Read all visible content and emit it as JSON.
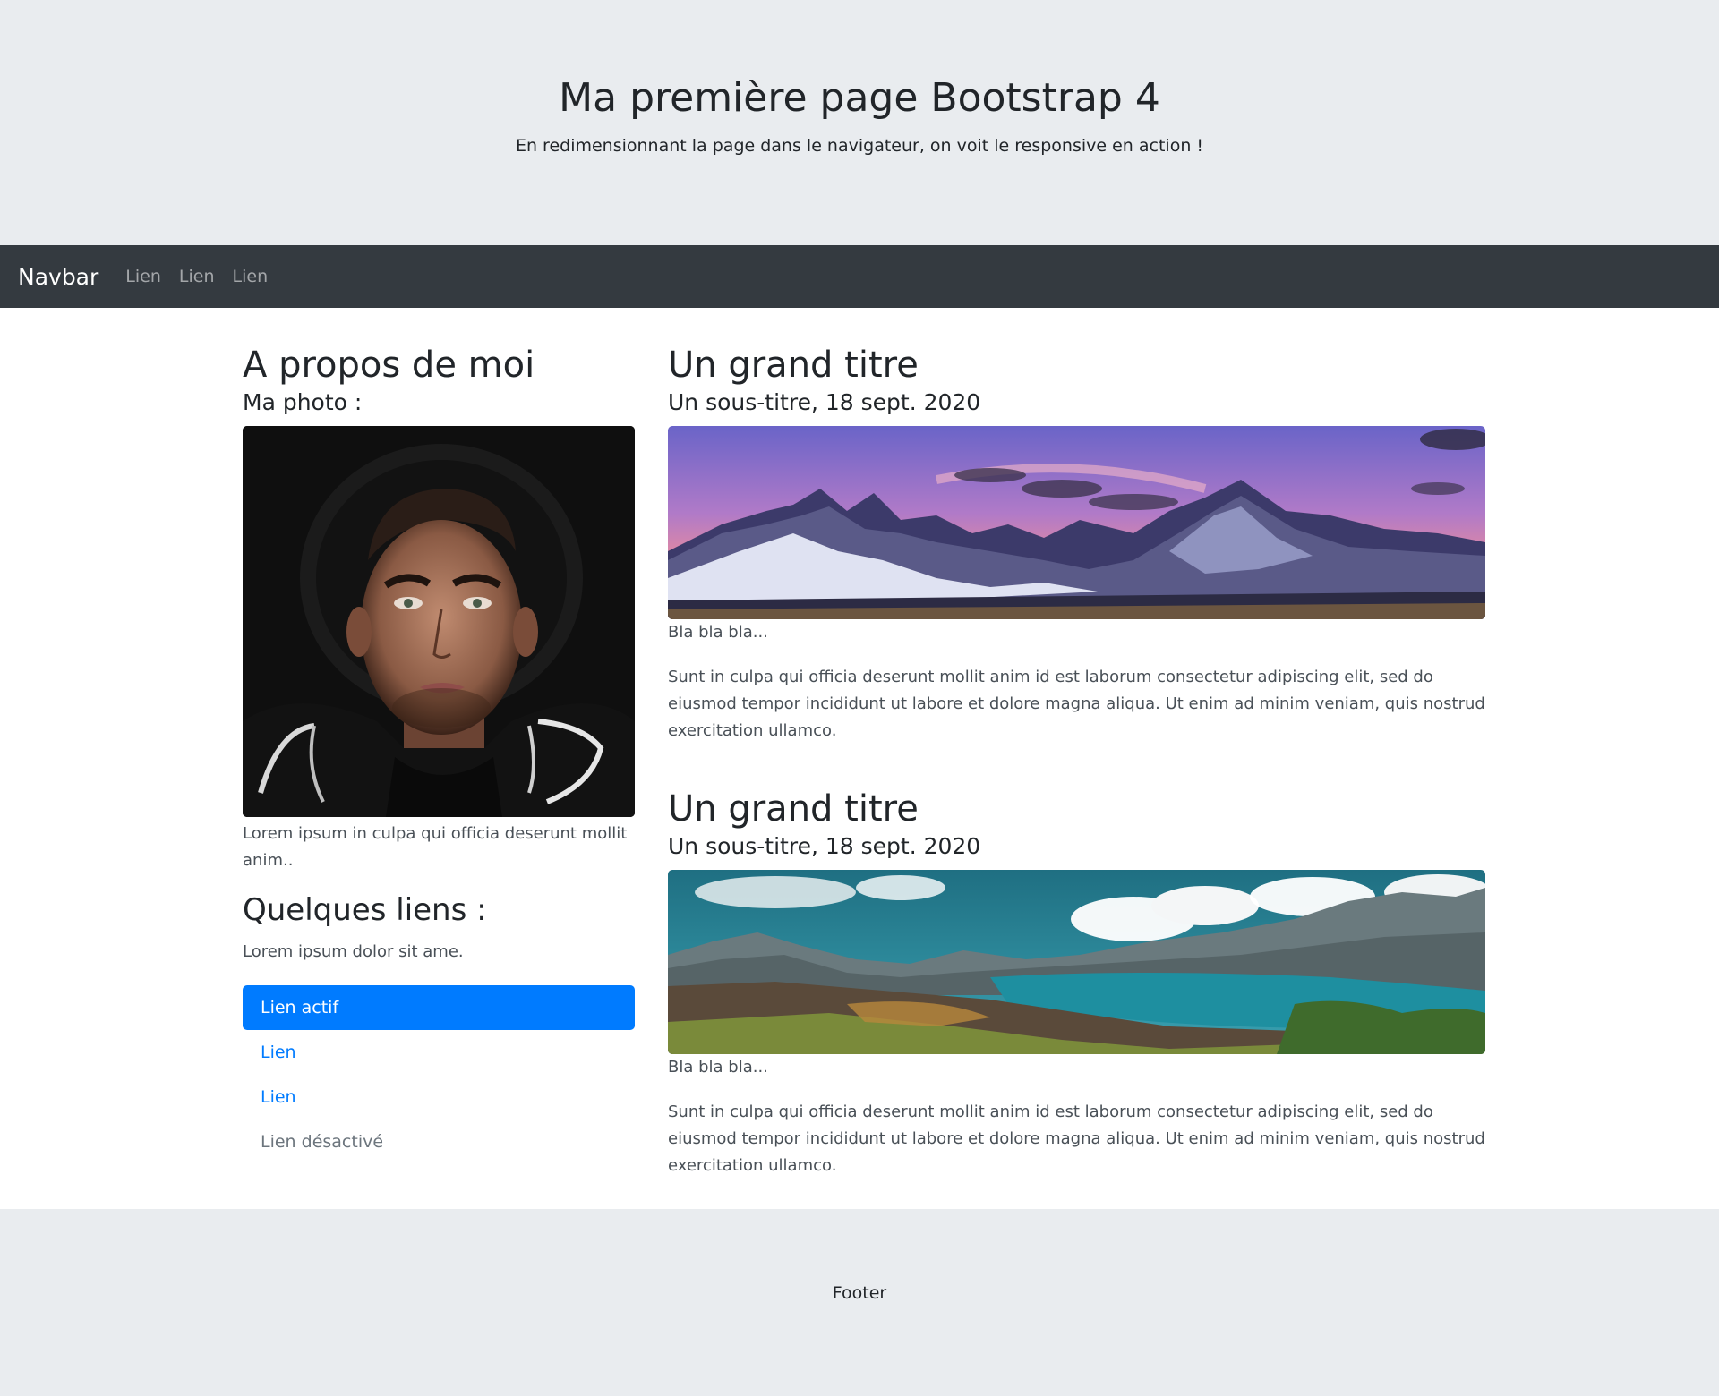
{
  "header": {
    "title": "Ma première page Bootstrap 4",
    "subtitle": "En redimensionnant la page dans le navigateur, on voit le responsive en action !"
  },
  "navbar": {
    "brand": "Navbar",
    "links": [
      "Lien",
      "Lien",
      "Lien"
    ]
  },
  "sidebar": {
    "title": "A propos de moi",
    "photo_label": "Ma photo :",
    "photo_caption": "Lorem ipsum in culpa qui officia deserunt mollit anim..",
    "links_title": "Quelques liens :",
    "links_text": "Lorem ipsum dolor sit ame.",
    "links": [
      {
        "label": "Lien actif",
        "state": "active"
      },
      {
        "label": "Lien",
        "state": "normal"
      },
      {
        "label": "Lien",
        "state": "normal"
      },
      {
        "label": "Lien désactivé",
        "state": "disabled"
      }
    ]
  },
  "articles": [
    {
      "title": "Un grand titre",
      "subtitle": "Un sous-titre, 18 sept. 2020",
      "caption": "Bla bla bla...",
      "body": "Sunt in culpa qui officia deserunt mollit anim id est laborum consectetur adipiscing elit, sed do eiusmod tempor incididunt ut labore et dolore magna aliqua. Ut enim ad minim veniam, quis nostrud exercitation ullamco."
    },
    {
      "title": "Un grand titre",
      "subtitle": "Un sous-titre, 18 sept. 2020",
      "caption": "Bla bla bla...",
      "body": "Sunt in culpa qui officia deserunt mollit anim id est laborum consectetur adipiscing elit, sed do eiusmod tempor incididunt ut labore et dolore magna aliqua. Ut enim ad minim veniam, quis nostrud exercitation ullamco."
    }
  ],
  "footer": {
    "text": "Footer"
  },
  "colors": {
    "jumbotron_bg": "#e9ecef",
    "navbar_bg": "#343a40",
    "primary": "#007bff",
    "disabled": "#6c757d"
  }
}
